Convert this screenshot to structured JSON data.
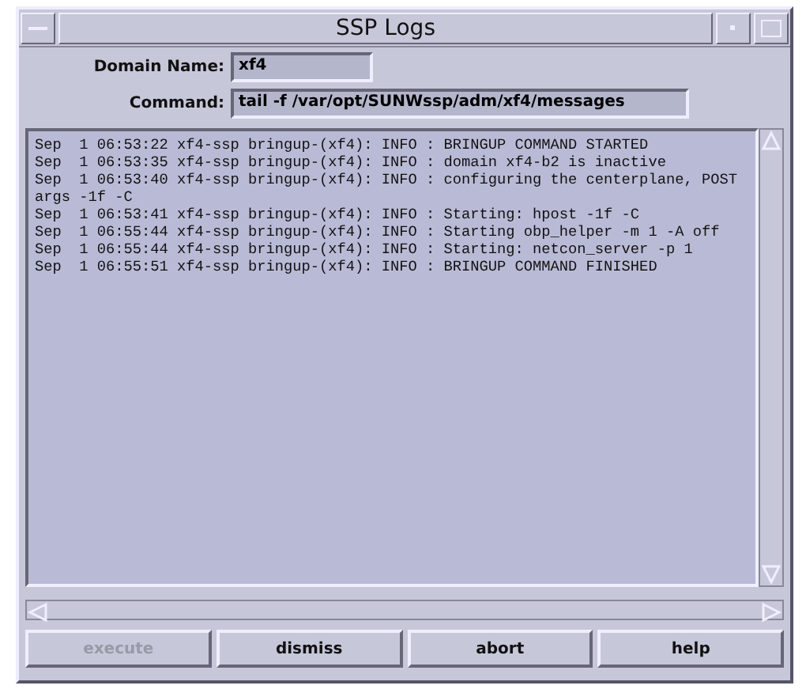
{
  "window": {
    "title": "SSP Logs"
  },
  "fields": [
    {
      "label": "Domain Name:",
      "value": "xf4"
    },
    {
      "label": "Command:",
      "value": "tail -f /var/opt/SUNWssp/adm/xf4/messages"
    }
  ],
  "log_lines": [
    "Sep  1 06:53:22 xf4-ssp bringup-(xf4): INFO : BRINGUP COMMAND STARTED",
    "Sep  1 06:53:35 xf4-ssp bringup-(xf4): INFO : domain xf4-b2 is inactive",
    "Sep  1 06:53:40 xf4-ssp bringup-(xf4): INFO : configuring the centerplane, POST",
    "args -1f -C",
    "Sep  1 06:53:41 xf4-ssp bringup-(xf4): INFO : Starting: hpost -1f -C",
    "Sep  1 06:55:44 xf4-ssp bringup-(xf4): INFO : Starting obp_helper -m 1 -A off",
    "Sep  1 06:55:44 xf4-ssp bringup-(xf4): INFO : Starting: netcon_server -p 1",
    "Sep  1 06:55:51 xf4-ssp bringup-(xf4): INFO : BRINGUP COMMAND FINISHED"
  ],
  "buttons": [
    {
      "label": "execute",
      "disabled": true
    },
    {
      "label": "dismiss",
      "disabled": false
    },
    {
      "label": "abort",
      "disabled": false
    },
    {
      "label": "help",
      "disabled": false
    }
  ]
}
